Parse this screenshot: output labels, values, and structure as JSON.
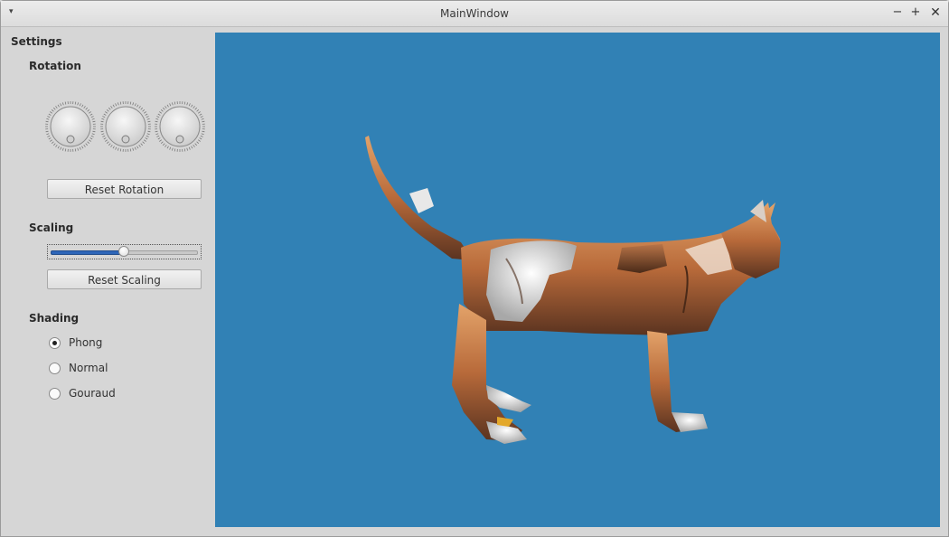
{
  "window": {
    "title": "MainWindow",
    "menu_glyph": "▾",
    "min_glyph": "−",
    "max_glyph": "+",
    "close_glyph": "✕"
  },
  "settings": {
    "title": "Settings",
    "rotation": {
      "title": "Rotation",
      "dials": [
        {
          "name": "x"
        },
        {
          "name": "y"
        },
        {
          "name": "z"
        }
      ],
      "reset_label": "Reset Rotation"
    },
    "scaling": {
      "title": "Scaling",
      "slider_value": 0.49,
      "reset_label": "Reset Scaling"
    },
    "shading": {
      "title": "Shading",
      "options": [
        {
          "label": "Phong",
          "checked": true
        },
        {
          "label": "Normal",
          "checked": false
        },
        {
          "label": "Gouraud",
          "checked": false
        }
      ]
    }
  },
  "viewport": {
    "background": "#3181b5",
    "model": "cat-model"
  },
  "colors": {
    "accent": "#2e66b8"
  }
}
